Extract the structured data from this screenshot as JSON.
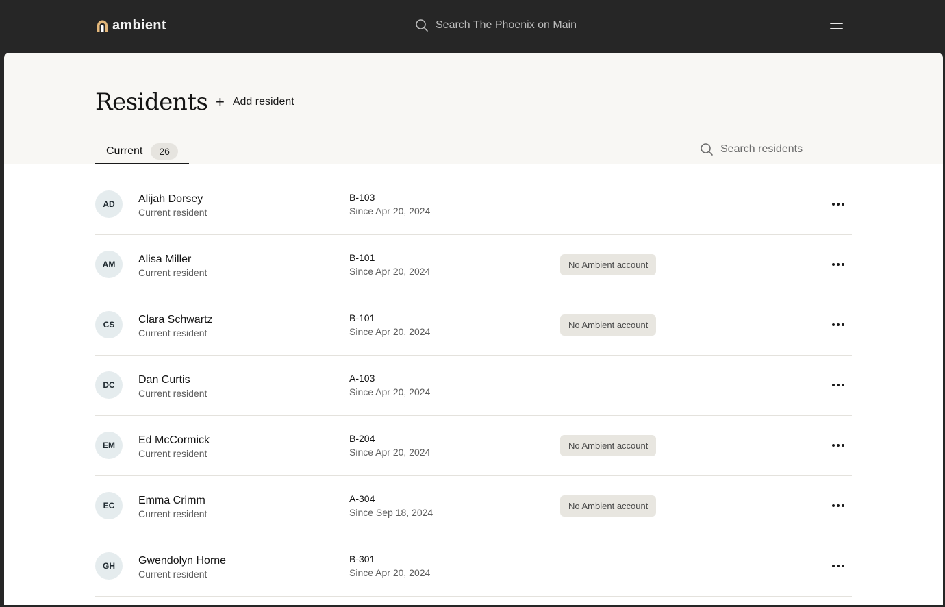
{
  "app": {
    "brand": "ambient",
    "search_placeholder": "Search The Phoenix on Main"
  },
  "page": {
    "title": "Residents",
    "add_label": "Add resident",
    "search_placeholder": "Search residents"
  },
  "tabs": [
    {
      "label": "Current",
      "count": "26",
      "active": true
    }
  ],
  "icons": {
    "logo": "ambient-logo-icon",
    "search": "search-icon",
    "menu": "hamburger-menu-icon",
    "add": "plus-icon",
    "more": "more-horizontal-icon"
  },
  "colors": {
    "topbar": "#262626",
    "header_bg": "#f8f7f4",
    "logo_accent": "#e3b77a",
    "avatar_bg": "#e5ecee",
    "badge_bg": "#e8e6e0"
  },
  "residents": [
    {
      "initials": "AD",
      "name": "Alijah Dorsey",
      "status": "Current resident",
      "unit": "B-103",
      "since": "Since Apr 20, 2024",
      "badge": ""
    },
    {
      "initials": "AM",
      "name": "Alisa Miller",
      "status": "Current resident",
      "unit": "B-101",
      "since": "Since Apr 20, 2024",
      "badge": "No Ambient account"
    },
    {
      "initials": "CS",
      "name": "Clara Schwartz",
      "status": "Current resident",
      "unit": "B-101",
      "since": "Since Apr 20, 2024",
      "badge": "No Ambient account"
    },
    {
      "initials": "DC",
      "name": "Dan Curtis",
      "status": "Current resident",
      "unit": "A-103",
      "since": "Since Apr 20, 2024",
      "badge": ""
    },
    {
      "initials": "EM",
      "name": "Ed McCormick",
      "status": "Current resident",
      "unit": "B-204",
      "since": "Since Apr 20, 2024",
      "badge": "No Ambient account"
    },
    {
      "initials": "EC",
      "name": "Emma Crimm",
      "status": "Current resident",
      "unit": "A-304",
      "since": "Since Sep 18, 2024",
      "badge": "No Ambient account"
    },
    {
      "initials": "GH",
      "name": "Gwendolyn Horne",
      "status": "Current resident",
      "unit": "B-301",
      "since": "Since Apr 20, 2024",
      "badge": ""
    }
  ]
}
